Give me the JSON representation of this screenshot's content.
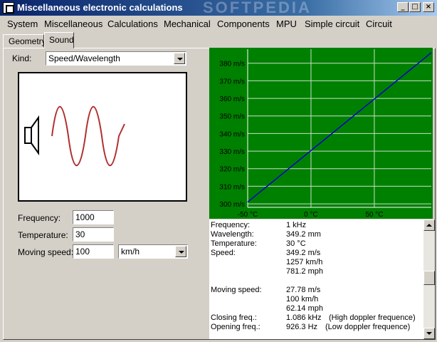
{
  "window": {
    "title": "Miscellaneous electronic calculations",
    "watermark": "SOFTPEDIA",
    "buttons": {
      "minimize": "_",
      "maximize": "□",
      "close": "×"
    }
  },
  "menu": [
    "System",
    "Miscellaneous",
    "Calculations",
    "Mechanical",
    "Components",
    "MPU",
    "Simple circuit",
    "Circuit"
  ],
  "tabs": [
    "Geometry",
    "Sound"
  ],
  "form": {
    "kind_label": "Kind:",
    "kind_value": "Speed/Wavelength",
    "frequency_label": "Frequency:",
    "frequency_value": "1000",
    "temperature_label": "Temperature:",
    "temperature_value": "30",
    "moving_speed_label": "Moving speed:",
    "moving_speed_value": "100",
    "speed_unit": "km/h"
  },
  "chart_data": {
    "type": "line",
    "title": "",
    "xlabel": "",
    "ylabel": "",
    "xlim": [
      -50,
      95
    ],
    "ylim": [
      298,
      388
    ],
    "x_ticks": [
      -50,
      0,
      50
    ],
    "x_tick_labels": [
      "-50 °C",
      "0 °C",
      "50 °C"
    ],
    "y_ticks": [
      300,
      310,
      320,
      330,
      340,
      350,
      360,
      370,
      380
    ],
    "y_tick_labels": [
      "300 m/s",
      "310 m/s",
      "320 m/s",
      "330 m/s",
      "340 m/s",
      "350 m/s",
      "360 m/s",
      "370 m/s",
      "380 m/s"
    ],
    "grid": true,
    "x": [
      -50,
      95
    ],
    "series": [
      {
        "values": [
          301.0,
          386.0
        ]
      }
    ],
    "colors": {
      "background": "#008000",
      "line": "#0000c8",
      "grid": "#c8e0c8"
    }
  },
  "results": {
    "frequency_label": "Frequency:",
    "frequency_value": "1 kHz",
    "wavelength_label": "Wavelength:",
    "wavelength_value": "349.2 mm",
    "temperature_label": "Temperature:",
    "temperature_value": "30 °C",
    "speed_label": "Speed:",
    "speed_ms": "349.2 m/s",
    "speed_kmh": "1257  km/h",
    "speed_mph": "781.2  mph",
    "moving_speed_label": "Moving speed:",
    "moving_ms": "27.78 m/s",
    "moving_kmh": "100  km/h",
    "moving_mph": "62.14  mph",
    "closing_label": "Closing freq.:",
    "closing_value": "1.086 kHz",
    "closing_note": "(High doppler frequence)",
    "opening_label": "Opening freq.:",
    "opening_value": "926.3 Hz",
    "opening_note": "(Low doppler frequence)"
  },
  "colors": {
    "titlebar": "#0a246a",
    "face": "#d4d0c8",
    "wave": "#b03030"
  }
}
